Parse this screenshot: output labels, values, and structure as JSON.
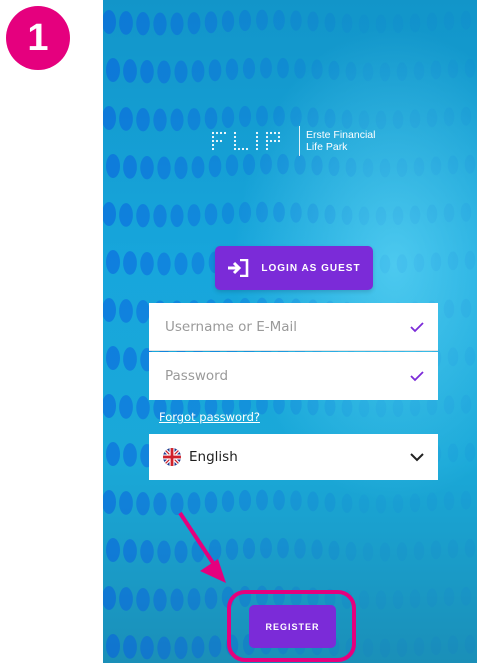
{
  "step_badge": {
    "number": "1"
  },
  "logo": {
    "wordmark": "FLIP",
    "line1": "Erste Financial",
    "line2": "Life Park"
  },
  "guest_button": {
    "label": "LOGIN AS GUEST",
    "icon": "login-icon"
  },
  "login_form": {
    "username_placeholder": "Username or E-Mail",
    "password_placeholder": "Password",
    "field_icon": "check-icon",
    "forgot_link": "Forgot password?"
  },
  "language": {
    "selected": "English",
    "flag_icon": "uk-flag-icon",
    "dropdown_icon": "chevron-down-icon"
  },
  "register_button": {
    "label": "REGISTER"
  },
  "annotation": {
    "arrow_icon": "arrow-icon",
    "highlight": "register-highlight"
  },
  "colors": {
    "accent_pink": "#e5007e",
    "button_purple": "#7b2bd8",
    "check_purple": "#7b2bd8",
    "background_blue": "#17a6dc",
    "dot_color": "#0a5fe0"
  }
}
